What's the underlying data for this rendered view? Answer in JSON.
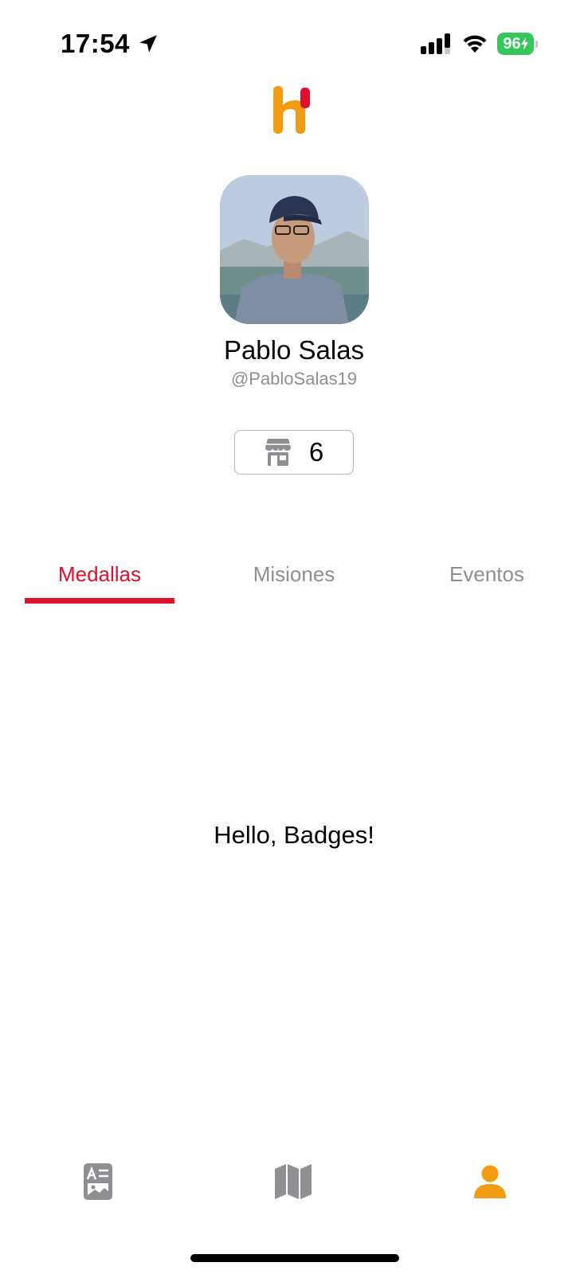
{
  "status_bar": {
    "time": "17:54",
    "battery": "96"
  },
  "profile": {
    "name": "Pablo Salas",
    "handle": "@PabloSalas19",
    "store_count": "6"
  },
  "tabs": [
    {
      "label": "Medallas",
      "active": true
    },
    {
      "label": "Misiones",
      "active": false
    },
    {
      "label": "Eventos",
      "active": false
    }
  ],
  "content": {
    "text": "Hello, Badges!"
  },
  "tab_bar": {
    "items": [
      {
        "icon": "news-icon",
        "active": false
      },
      {
        "icon": "map-icon",
        "active": false
      },
      {
        "icon": "person-icon",
        "active": true
      }
    ]
  },
  "colors": {
    "accent": "#e0102b",
    "brand_orange": "#f39c12",
    "inactive_gray": "#8e8e93",
    "battery_green": "#34c759"
  }
}
